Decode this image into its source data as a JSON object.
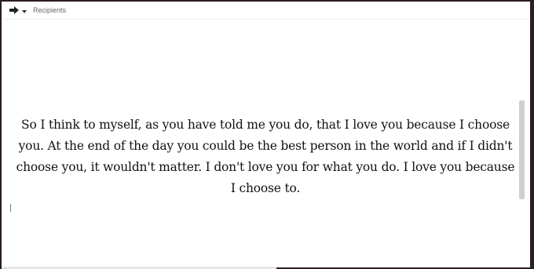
{
  "header": {
    "send_icon": "arrow-right-icon",
    "caret_icon": "caret-down-icon",
    "recipients_label": "Recipients"
  },
  "message": {
    "text": "So I think to myself, as you have told me you do, that I love you because I choose you. At the end of the day you could be the best person in the world and if I didn't choose you, it wouldn't matter. I don't love you for what you do. I love you because I choose to."
  },
  "colors": {
    "text": "#111111",
    "background": "#ffffff",
    "scrollbar": "#cfcfcf"
  }
}
